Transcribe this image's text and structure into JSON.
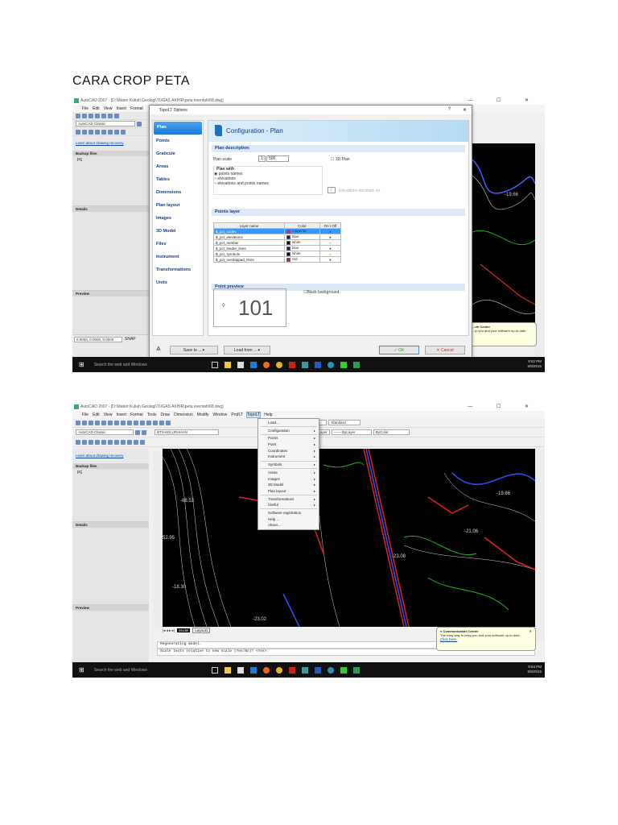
{
  "document": {
    "title": "CARA CROP PETA"
  },
  "shot1": {
    "window_title": "AutoCAD 2007 - [D:\\Materi Kuliah Geologi\\TUGAS AKHIR\\peta eventah\\68.dwg]",
    "menu": [
      "File",
      "Edit",
      "View",
      "Insert",
      "Format"
    ],
    "workspace": "AutoCAD Classic",
    "recovery_link": "Learn about drawing recovery",
    "backup_files": "Backup files",
    "backup_item": "P6",
    "details": "Details",
    "preview": "Preview",
    "coords": "0.0000, 0.0000, 0.0000",
    "snap": "SNAP",
    "drawing_label": "-19.66",
    "dialog": {
      "title": "TopoLT Options",
      "close": "✕",
      "help": "?",
      "nav": [
        "Plan",
        "Points",
        "Graticule",
        "Areas",
        "Tables",
        "Dimensions",
        "Plan layout",
        "Images",
        "3D Model",
        "Files",
        "Instrument",
        "Transformations",
        "Units"
      ],
      "heading": "Configuration - Plan",
      "plan_description": "Plan description",
      "plan_scale_label": "Plan scale",
      "plan_scale_prefix": "1:",
      "plan_scale_value": "500",
      "plan_3d": "3D Plan",
      "plan_with": "Plan with",
      "radio_options": [
        "points names",
        "elevations",
        "elevations and points names"
      ],
      "selected_radio": "points names",
      "decimals_value": "2",
      "decimals_label": "Elevations decimals no.",
      "points_layer": "Points layer",
      "table_headers": [
        "Layer name",
        "Color",
        "On / Off"
      ],
      "layers": [
        {
          "name": "$_pct_codes",
          "color": "magenta",
          "hex": "#e010d0",
          "on": false
        },
        {
          "name": "$_pct_elevations",
          "color": "blue",
          "hex": "#1010c0",
          "on": false
        },
        {
          "name": "$_pct_number",
          "color": "white",
          "hex": "#000000",
          "on": true
        },
        {
          "name": "$_pct_leader_lines",
          "color": "blue",
          "hex": "#1010c0",
          "on": false
        },
        {
          "name": "$_pct_symbols",
          "color": "white",
          "hex": "#000000",
          "on": true
        },
        {
          "name": "$_pct_overlapped_texts",
          "color": "red",
          "hex": "#e01010",
          "on": false
        }
      ],
      "point_preview": "Point preview",
      "preview_number": "101",
      "black_background": "Black background",
      "save_to": "Save to ... ▾",
      "load_from": "Load from ... ▾",
      "ok": "✓ OK",
      "cancel": "✕ Cancel"
    },
    "comm_title": "...on Center",
    "comm_text": "...lp you and your software up-to-date.",
    "taskbar_search": "Search the web and Windows",
    "clock_time": "9:52 PM",
    "clock_date": "5/9/2016"
  },
  "shot2": {
    "window_title": "AutoCAD 2007 - [D:\\Materi Kuliah Geologi\\TUGAS AKHIR\\peta eventah\\68.dwg]",
    "menu": [
      "File",
      "Edit",
      "View",
      "Insert",
      "Format",
      "Tools",
      "Draw",
      "Dimension",
      "Modify",
      "Window",
      "ProfLT",
      "TopoLT",
      "Help"
    ],
    "active_menu": "TopoLT",
    "workspace": "AutoCAD Classic",
    "layer": "BTS-KELURAHAN",
    "text_style": "STANDARD",
    "dim_style": "STANDARD",
    "table_style": "Standard",
    "linetype": "-------- ByLayer",
    "lineweight": "—— ByLayer",
    "plotstyle": "ByColor",
    "recovery_link": "Learn about drawing recovery",
    "backup_files": "Backup files",
    "backup_item": "P6",
    "details": "Details",
    "preview": "Preview",
    "dropdown": [
      {
        "label": "Load...",
        "sub": false
      },
      {
        "sep": true
      },
      {
        "label": "Configuration",
        "sub": true
      },
      {
        "sep": true
      },
      {
        "label": "Points",
        "sub": true
      },
      {
        "label": "Point",
        "sub": true
      },
      {
        "label": "Coordinates",
        "sub": true
      },
      {
        "label": "Instrument",
        "sub": true
      },
      {
        "sep": true
      },
      {
        "label": "Symbols",
        "sub": true
      },
      {
        "sep": true
      },
      {
        "label": "Areas",
        "sub": true
      },
      {
        "label": "Images",
        "sub": true
      },
      {
        "label": "3D Model",
        "sub": true
      },
      {
        "label": "Plan layout",
        "sub": true
      },
      {
        "sep": true
      },
      {
        "label": "Transformations",
        "sub": true
      },
      {
        "label": "Useful",
        "sub": true
      },
      {
        "sep": true
      },
      {
        "label": "Software registration",
        "sub": false
      },
      {
        "label": "Help ...",
        "sub": false
      },
      {
        "label": "About...",
        "sub": false
      }
    ],
    "drawing_labels": [
      "-19.66",
      "-21.06",
      "-23.08",
      "-68.53",
      "-18.30",
      "-23.02",
      "52.95"
    ],
    "tabs": [
      "Model",
      "Layout1"
    ],
    "command_lines": [
      "Regenerating model.",
      "Scale texts relative to new scale (Yes/No)? <Yes>:"
    ],
    "comm_title": "Communication Center",
    "comm_text": "The easy way to keep you and your software up-to-date.",
    "comm_link": "Click here.",
    "taskbar_search": "Search the web and Windows",
    "clock_time": "9:54 PM",
    "clock_date": "5/9/2016"
  }
}
